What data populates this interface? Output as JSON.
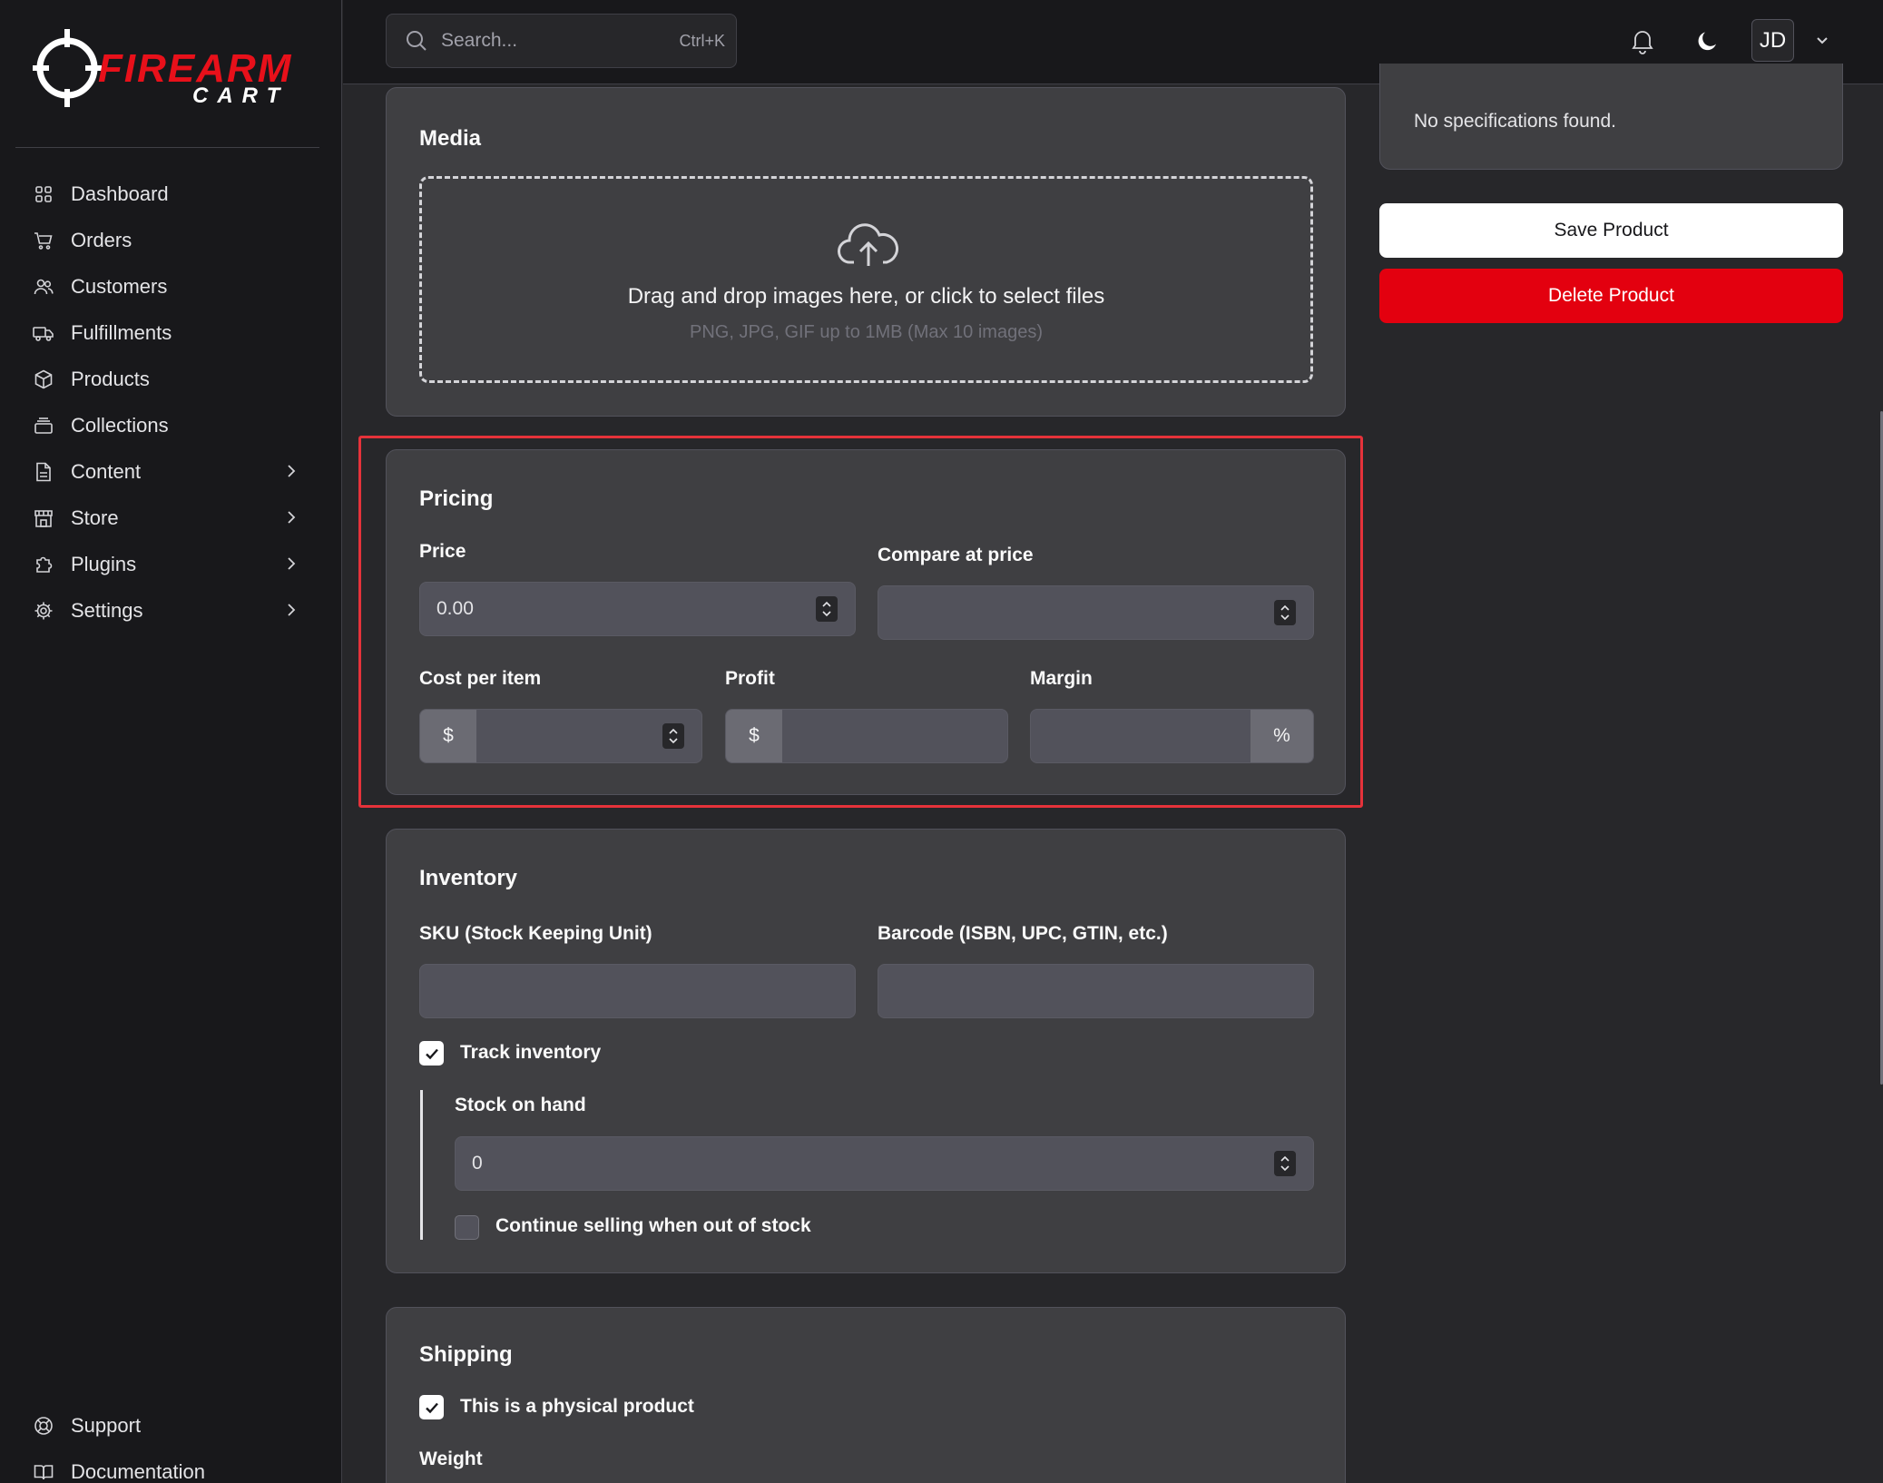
{
  "brand": {
    "logo_top": "FIREARM",
    "logo_bottom": "CART"
  },
  "sidebar": {
    "items": [
      {
        "label": "Dashboard",
        "icon": "dashboard-icon",
        "has_submenu": false
      },
      {
        "label": "Orders",
        "icon": "cart-icon",
        "has_submenu": false
      },
      {
        "label": "Customers",
        "icon": "users-icon",
        "has_submenu": false
      },
      {
        "label": "Fulfillments",
        "icon": "truck-icon",
        "has_submenu": false
      },
      {
        "label": "Products",
        "icon": "box-icon",
        "has_submenu": false
      },
      {
        "label": "Collections",
        "icon": "collection-icon",
        "has_submenu": false
      },
      {
        "label": "Content",
        "icon": "document-icon",
        "has_submenu": true
      },
      {
        "label": "Store",
        "icon": "store-icon",
        "has_submenu": true
      },
      {
        "label": "Plugins",
        "icon": "puzzle-icon",
        "has_submenu": true
      },
      {
        "label": "Settings",
        "icon": "gear-icon",
        "has_submenu": true
      }
    ],
    "bottom_items": [
      {
        "label": "Support",
        "icon": "lifebuoy-icon"
      },
      {
        "label": "Documentation",
        "icon": "book-icon"
      }
    ]
  },
  "topbar": {
    "search_placeholder": "Search...",
    "search_shortcut": "Ctrl+K",
    "avatar_initials": "JD"
  },
  "specifications": {
    "empty_text": "No specifications found."
  },
  "actions": {
    "save_label": "Save Product",
    "delete_label": "Delete Product"
  },
  "media": {
    "title": "Media",
    "drop_text": "Drag and drop images here, or click to select files",
    "drop_hint": "PNG, JPG, GIF up to 1MB (Max 10 images)"
  },
  "pricing": {
    "title": "Pricing",
    "price_label": "Price",
    "price_value": "0.00",
    "compare_label": "Compare at price",
    "compare_value": "",
    "cost_label": "Cost per item",
    "cost_prefix": "$",
    "profit_label": "Profit",
    "profit_prefix": "$",
    "margin_label": "Margin",
    "margin_suffix": "%"
  },
  "inventory": {
    "title": "Inventory",
    "sku_label": "SKU (Stock Keeping Unit)",
    "barcode_label": "Barcode (ISBN, UPC, GTIN, etc.)",
    "track_label": "Track inventory",
    "track_checked": true,
    "stock_label": "Stock on hand",
    "stock_value": "0",
    "continue_label": "Continue selling when out of stock",
    "continue_checked": false
  },
  "shipping": {
    "title": "Shipping",
    "physical_label": "This is a physical product",
    "physical_checked": true,
    "weight_label": "Weight"
  },
  "colors": {
    "accent_red": "#e3000f",
    "background": "#27272a",
    "sidebar_bg": "#18181b",
    "card_bg": "#3f3f42",
    "highlight": "#e5323a"
  }
}
